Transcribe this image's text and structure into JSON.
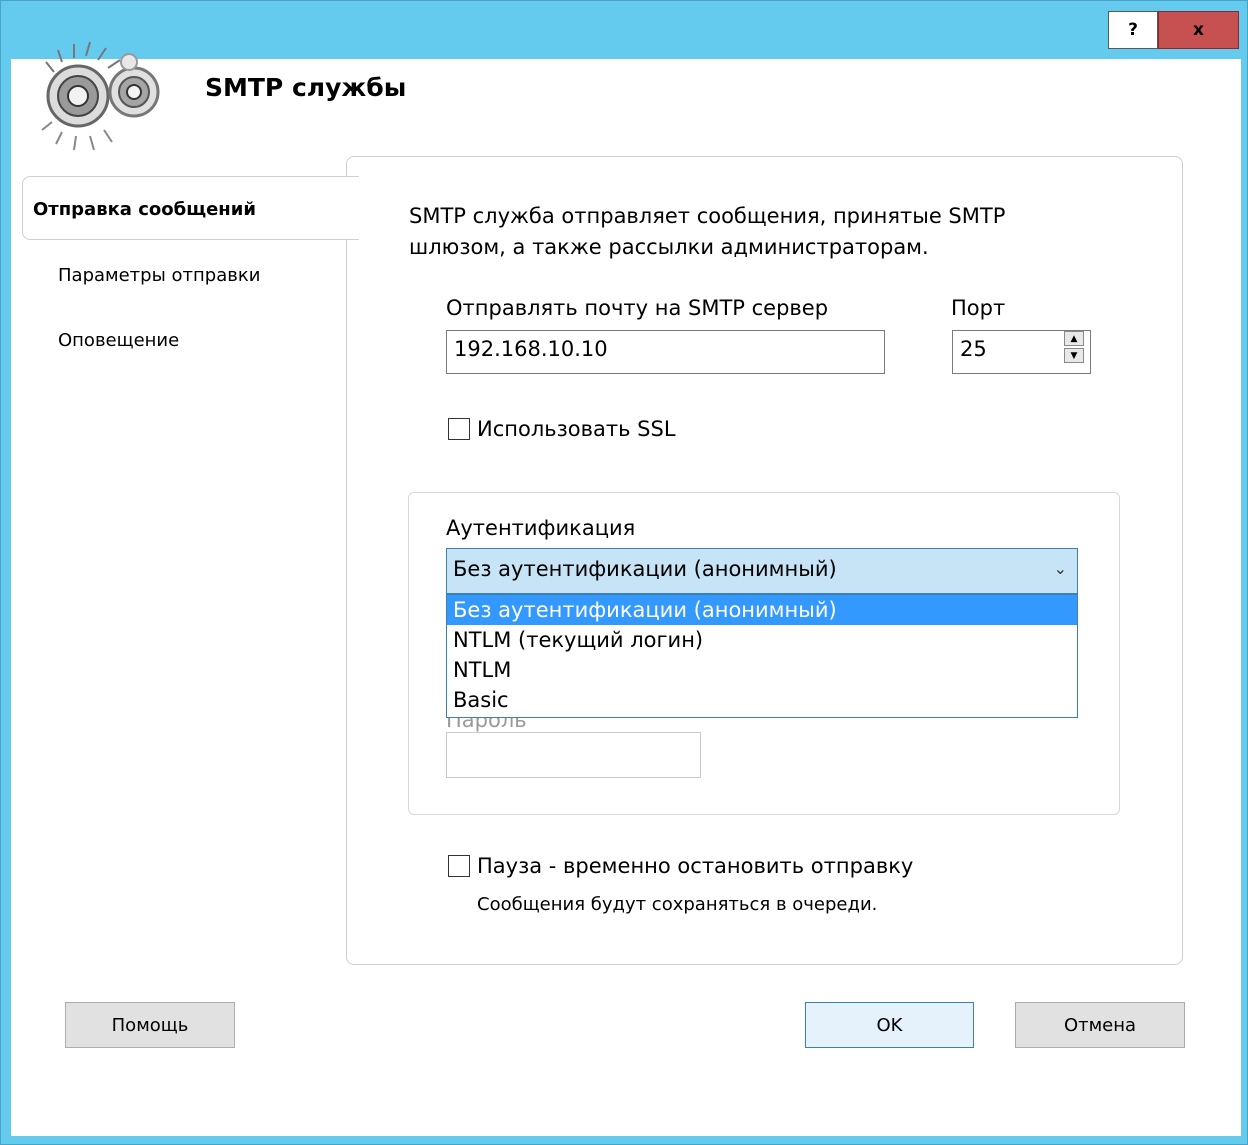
{
  "titlebar": {
    "help_label": "?",
    "close_label": "x"
  },
  "header": {
    "title": "SMTP службы",
    "icon": "gears-icon"
  },
  "nav": {
    "items": [
      {
        "label": "Отправка сообщений",
        "active": true
      },
      {
        "label": "Параметры отправки",
        "active": false
      },
      {
        "label": "Оповещение",
        "active": false
      }
    ]
  },
  "main": {
    "description_line1": "SMTP служба отправляет сообщения, принятые SMTP",
    "description_line2": "шлюзом, а также рассылки администраторам.",
    "server_label": "Отправлять почту на SMTP сервер",
    "server_value": "192.168.10.10",
    "port_label": "Порт",
    "port_value": "25",
    "ssl_label": "Использовать SSL",
    "ssl_checked": false,
    "auth": {
      "label": "Аутентификация",
      "selected": "Без аутентификации (анонимный)",
      "options": [
        "Без аутентификации (анонимный)",
        "NTLM (текущий логин)",
        "NTLM",
        "Basic"
      ],
      "password_label": "Пароль",
      "password_value": ""
    },
    "pause_label": "Пауза - временно остановить отправку",
    "pause_checked": false,
    "pause_note": "Сообщения будут сохраняться в очереди."
  },
  "footer": {
    "help_label": "Помощь",
    "ok_label": "OK",
    "cancel_label": "Отмена"
  },
  "colors": {
    "titlebar": "#64cbee",
    "close": "#c75050",
    "selection": "#3399ff",
    "combo_bg": "#c7e4f7"
  }
}
